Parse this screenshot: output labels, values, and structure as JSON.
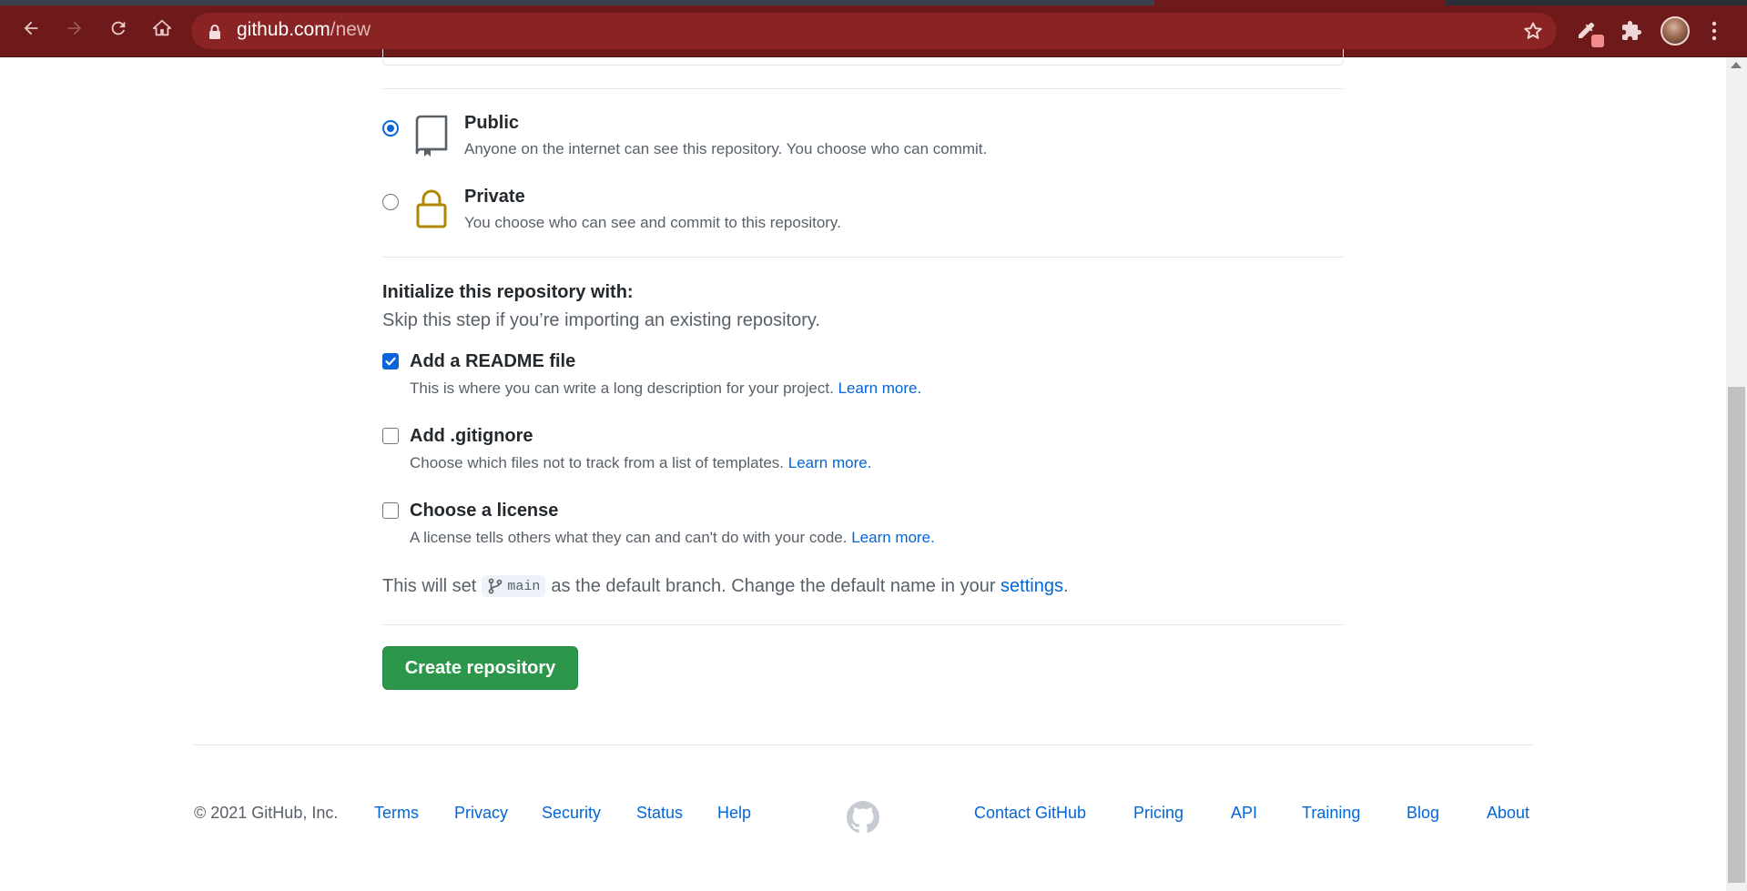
{
  "browser": {
    "url_host": "github.com",
    "url_path": "/new"
  },
  "visibility": {
    "options": [
      {
        "title": "Public",
        "description": "Anyone on the internet can see this repository. You choose who can commit.",
        "selected": true,
        "icon": "repo-icon"
      },
      {
        "title": "Private",
        "description": "You choose who can see and commit to this repository.",
        "selected": false,
        "icon": "lock-icon"
      }
    ]
  },
  "initialize": {
    "title": "Initialize this repository with:",
    "subtitle": "Skip this step if you’re importing an existing repository.",
    "items": [
      {
        "label": "Add a README file",
        "description": "This is where you can write a long description for your project.",
        "link": "Learn more.",
        "checked": true
      },
      {
        "label": "Add .gitignore",
        "description": "Choose which files not to track from a list of templates.",
        "link": "Learn more.",
        "checked": false
      },
      {
        "label": "Choose a license",
        "description": "A license tells others what they can and can't do with your code.",
        "link": "Learn more.",
        "checked": false
      }
    ]
  },
  "branch": {
    "prefix": "This will set",
    "name": "main",
    "middle": "as the default branch. Change the default name in your",
    "settings_link": "settings",
    "suffix": "."
  },
  "create_button": "Create repository",
  "footer": {
    "copyright": "© 2021 GitHub, Inc.",
    "left_links": [
      "Terms",
      "Privacy",
      "Security",
      "Status",
      "Help"
    ],
    "right_links": [
      "Contact GitHub",
      "Pricing",
      "API",
      "Training",
      "Blog",
      "About"
    ]
  },
  "colors": {
    "browser_frame": "#6e1a1a",
    "accent_blue": "#0366d6",
    "button_green": "#2c974b",
    "private_icon": "#b08800"
  }
}
